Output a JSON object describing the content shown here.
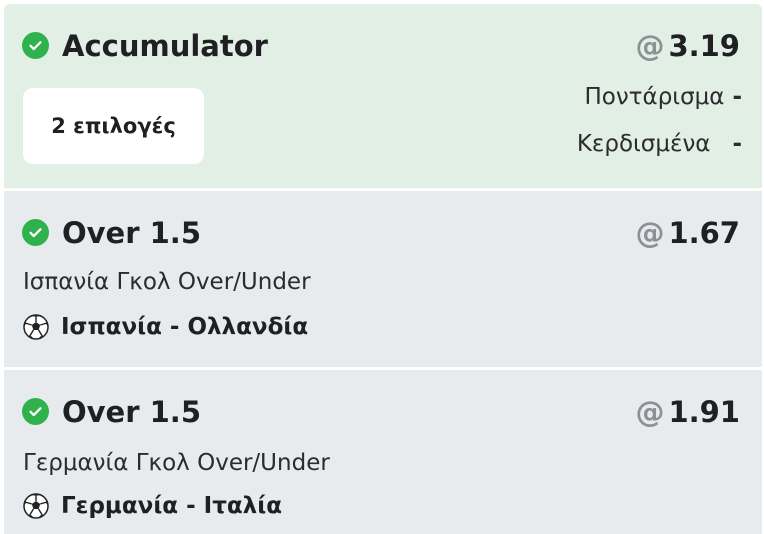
{
  "header": {
    "title": "Accumulator",
    "odds_prefix": "@",
    "odds": "3.19",
    "selections_label": "2 επιλογές",
    "stake_label": "Ποντάρισμα",
    "stake_value": "-",
    "winnings_label": "Κερδισμένα",
    "winnings_value": "-"
  },
  "selections": [
    {
      "title": "Over 1.5",
      "odds_prefix": "@",
      "odds": "1.67",
      "market": "Ισπανία Γκολ Over/Under",
      "match": "Ισπανία - Ολλανδία",
      "icon": "soccer-ball-icon"
    },
    {
      "title": "Over 1.5",
      "odds_prefix": "@",
      "odds": "1.91",
      "market": "Γερμανία Γκολ Over/Under",
      "match": "Γερμανία - Ιταλία",
      "icon": "soccer-ball-icon"
    }
  ],
  "colors": {
    "header_bg": "#e2efe5",
    "selection_bg": "#e8ebee",
    "check_green": "#2fb24c",
    "at_grey": "#8d9196"
  }
}
